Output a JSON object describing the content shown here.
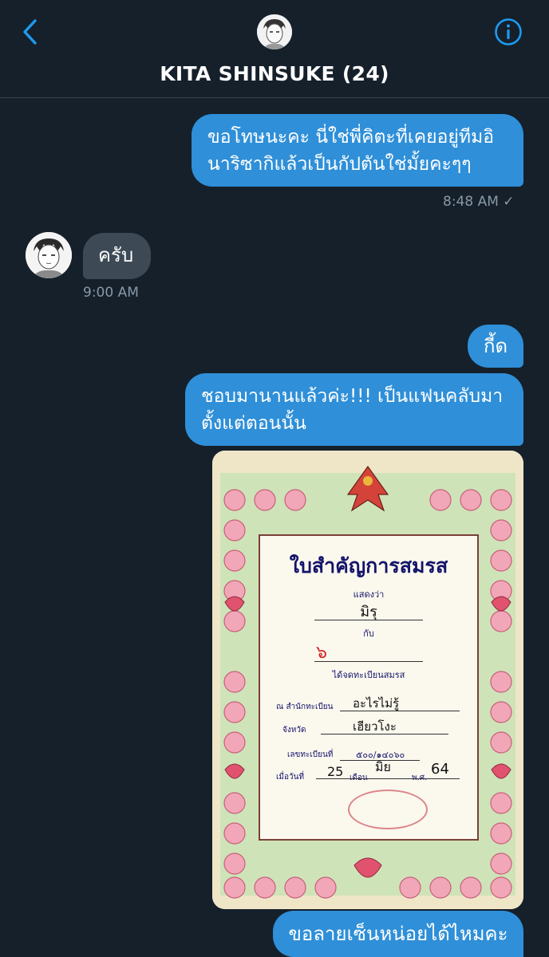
{
  "header": {
    "title": "KITA SHINSUKE (24)"
  },
  "messages": {
    "m1": {
      "line1": "ขอโทษนะคะ นี่ใช่พี่คิตะที่เคยอยู่ทีมอิ",
      "line2": "นาริซากิแล้วเป็นกัปตันใช่มั้ยคะๆๆ",
      "time": "8:48 AM ✓"
    },
    "m2": {
      "text": "ครับ",
      "time": "9:00 AM"
    },
    "m3": {
      "text": "กี้ด"
    },
    "m4": {
      "line1": "ชอบมานานแล้วค่ะ!!! เป็นแฟนคลับมา",
      "line2": "ตั้งแต่ตอนนั้น"
    },
    "m5": {
      "text": "ขอลายเซ็นหน่อยได้ไหมคะ"
    }
  },
  "certificate": {
    "title": "ใบสำคัญการสมรส",
    "shows": "แสดงว่า",
    "name1": "มิรุ",
    "with": "กับ",
    "name2": "๖",
    "registered": "ได้จดทะเบียนสมรส",
    "office_label": "ณ สำนักทะเบียน",
    "office_value": "อะไรไม่รู้",
    "province_label": "จังหวัด",
    "province_value": "เฮียวโงะ",
    "regno_label": "เลขทะเบียนที่",
    "regno_value": "๕๐๐/๑๔๐๖๐",
    "date_label": "เมื่อวันที่",
    "day": "25",
    "month_label": "เดือน",
    "month": "มิย",
    "year_label": "พ.ศ.",
    "year": "64"
  },
  "colors": {
    "background": "#15202b",
    "outgoing_bubble": "#2f8fd8",
    "incoming_bubble": "#3d4a56",
    "accent": "#1d9bf0"
  },
  "icons": {
    "back": "chevron-left-icon",
    "info": "info-icon"
  }
}
